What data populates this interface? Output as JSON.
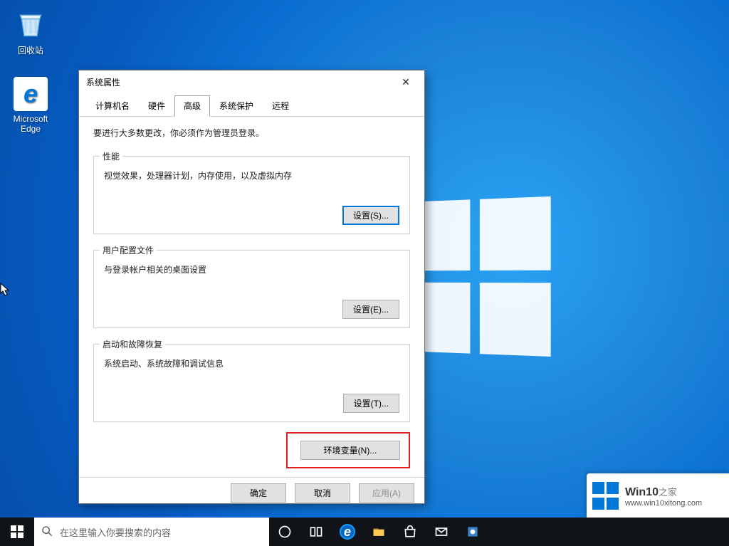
{
  "desktop_icons": {
    "recycle_bin": "回收站",
    "edge": "Microsoft Edge"
  },
  "dialog": {
    "title": "系统属性",
    "close_symbol": "✕",
    "tabs": [
      "计算机名",
      "硬件",
      "高级",
      "系统保护",
      "远程"
    ],
    "active_tab": "高级",
    "instruction": "要进行大多数更改，你必须作为管理员登录。",
    "groups": {
      "performance": {
        "legend": "性能",
        "text": "视觉效果，处理器计划，内存使用，以及虚拟内存",
        "button": "设置(S)..."
      },
      "userprofile": {
        "legend": "用户配置文件",
        "text": "与登录帐户相关的桌面设置",
        "button": "设置(E)..."
      },
      "startup": {
        "legend": "启动和故障恢复",
        "text": "系统启动、系统故障和调试信息",
        "button": "设置(T)..."
      }
    },
    "env_button": "环境变量(N)...",
    "footer": {
      "ok": "确定",
      "cancel": "取消",
      "apply": "应用(A)"
    }
  },
  "taskbar": {
    "search_placeholder": "在这里输入你要搜索的内容"
  },
  "watermark": {
    "brand_en": "Win10",
    "brand_cn": "之家",
    "url": "www.win10xitong.com"
  }
}
